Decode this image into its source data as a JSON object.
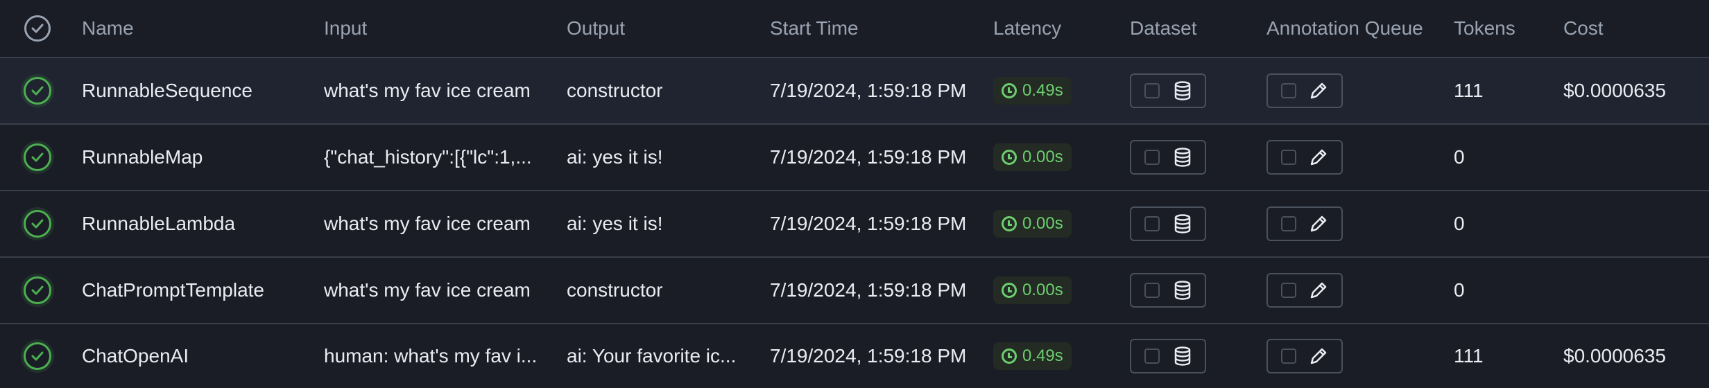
{
  "header": {
    "name": "Name",
    "input": "Input",
    "output": "Output",
    "start_time": "Start Time",
    "latency": "Latency",
    "dataset": "Dataset",
    "annotation_queue": "Annotation Queue",
    "tokens": "Tokens",
    "cost": "Cost"
  },
  "rows": [
    {
      "name": "RunnableSequence",
      "input": "what's my fav ice cream",
      "output": "constructor",
      "start_time": "7/19/2024, 1:59:18 PM",
      "latency": "0.49s",
      "tokens": "111",
      "cost": "$0.0000635"
    },
    {
      "name": "RunnableMap",
      "input": "{\"chat_history\":[{\"lc\":1,...",
      "output": "ai: yes it is!",
      "start_time": "7/19/2024, 1:59:18 PM",
      "latency": "0.00s",
      "tokens": "0",
      "cost": ""
    },
    {
      "name": "RunnableLambda",
      "input": "what's my fav ice cream",
      "output": "ai: yes it is!",
      "start_time": "7/19/2024, 1:59:18 PM",
      "latency": "0.00s",
      "tokens": "0",
      "cost": ""
    },
    {
      "name": "ChatPromptTemplate",
      "input": "what's my fav ice cream",
      "output": "constructor",
      "start_time": "7/19/2024, 1:59:18 PM",
      "latency": "0.00s",
      "tokens": "0",
      "cost": ""
    },
    {
      "name": "ChatOpenAI",
      "input": "human: what's my fav i...",
      "output": "ai: Your favorite ic...",
      "start_time": "7/19/2024, 1:59:18 PM",
      "latency": "0.49s",
      "tokens": "111",
      "cost": "$0.0000635"
    }
  ],
  "colors": {
    "background": "#1a1d26",
    "selected_row": "#1f2430",
    "success": "#4caf50",
    "latency_text": "#6ccf6f"
  },
  "icons": {
    "status": "check-circle-icon",
    "latency": "clock-icon",
    "dataset": "database-icon",
    "annotation": "pencil-icon"
  }
}
